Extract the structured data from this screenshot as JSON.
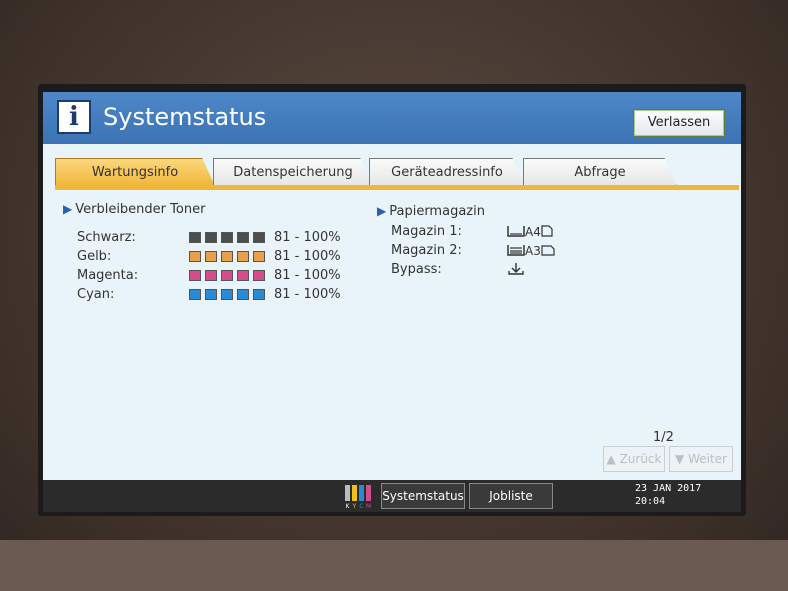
{
  "header": {
    "title": "Systemstatus",
    "exit_label": "Verlassen"
  },
  "tabs": [
    {
      "label": "Wartungsinfo",
      "active": true
    },
    {
      "label": "Datenspeicherung",
      "active": false
    },
    {
      "label": "Geräteadressinfo",
      "active": false
    },
    {
      "label": "Abfrage",
      "active": false
    }
  ],
  "toner": {
    "heading": "Verbleibender Toner",
    "rows": [
      {
        "label": "Schwarz:",
        "level": "81 - 100%",
        "color": "#4d4d4d"
      },
      {
        "label": "Gelb:",
        "level": "81 - 100%",
        "color": "#e8a04a"
      },
      {
        "label": "Magenta:",
        "level": "81 - 100%",
        "color": "#d44c8c"
      },
      {
        "label": "Cyan:",
        "level": "81 - 100%",
        "color": "#2a8ad4"
      }
    ]
  },
  "paper": {
    "heading": "Papiermagazin",
    "rows": [
      {
        "label": "Magazin 1:",
        "size": "A4"
      },
      {
        "label": "Magazin 2:",
        "size": "A3"
      },
      {
        "label": "Bypass:",
        "size": ""
      }
    ]
  },
  "pagination": {
    "page": "1/2",
    "back_label": "Zurück",
    "next_label": "Weiter"
  },
  "bottom_bar": {
    "toner_letters": "KYCM",
    "system_status": "Systemstatus",
    "job_list": "Jobliste",
    "date": "23 JAN  2017",
    "time": "20:04"
  }
}
